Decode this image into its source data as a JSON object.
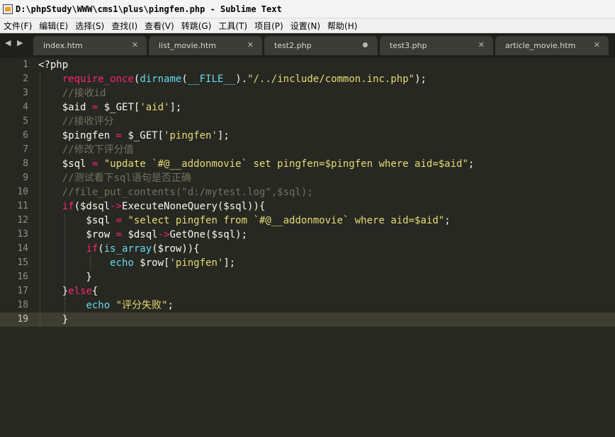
{
  "window": {
    "title": "D:\\phpStudy\\WWW\\cms1\\plus\\pingfen.php - Sublime Text"
  },
  "menu": [
    "文件(F)",
    "编辑(E)",
    "选择(S)",
    "查找(I)",
    "查看(V)",
    "转跳(G)",
    "工具(T)",
    "项目(P)",
    "设置(N)",
    "帮助(H)"
  ],
  "tabs": [
    {
      "label": "index.htm",
      "state": "close"
    },
    {
      "label": "list_movie.htm",
      "state": "close"
    },
    {
      "label": "test2.php",
      "state": "dirty"
    },
    {
      "label": "test3.php",
      "state": "close"
    },
    {
      "label": "article_movie.htm",
      "state": "close"
    }
  ],
  "nav": {
    "back": "◀",
    "forward": "▶"
  },
  "editor": {
    "current_line": 19,
    "lines": [
      [
        {
          "t": "<?php",
          "c": "pl"
        }
      ],
      [
        {
          "t": "    ",
          "c": "pl"
        },
        {
          "t": "require_once",
          "c": "kw"
        },
        {
          "t": "(",
          "c": "pl"
        },
        {
          "t": "dirname",
          "c": "fn"
        },
        {
          "t": "(",
          "c": "pl"
        },
        {
          "t": "__FILE__",
          "c": "fn"
        },
        {
          "t": ").",
          "c": "pl"
        },
        {
          "t": "\"/../include/common.inc.php\"",
          "c": "str"
        },
        {
          "t": ");",
          "c": "pl"
        }
      ],
      [
        {
          "t": "    ",
          "c": "pl"
        },
        {
          "t": "//接收id",
          "c": "cm"
        }
      ],
      [
        {
          "t": "    $aid ",
          "c": "pl"
        },
        {
          "t": "=",
          "c": "op"
        },
        {
          "t": " $_GET[",
          "c": "pl"
        },
        {
          "t": "'aid'",
          "c": "str"
        },
        {
          "t": "];",
          "c": "pl"
        }
      ],
      [
        {
          "t": "    ",
          "c": "pl"
        },
        {
          "t": "//接收评分",
          "c": "cm"
        }
      ],
      [
        {
          "t": "    $pingfen ",
          "c": "pl"
        },
        {
          "t": "=",
          "c": "op"
        },
        {
          "t": " $_GET[",
          "c": "pl"
        },
        {
          "t": "'pingfen'",
          "c": "str"
        },
        {
          "t": "];",
          "c": "pl"
        }
      ],
      [
        {
          "t": "    ",
          "c": "pl"
        },
        {
          "t": "//修改下评分值",
          "c": "cm"
        }
      ],
      [
        {
          "t": "    $sql ",
          "c": "pl"
        },
        {
          "t": "=",
          "c": "op"
        },
        {
          "t": " ",
          "c": "pl"
        },
        {
          "t": "\"update `#@__addonmovie` set pingfen=$pingfen where aid=$aid\"",
          "c": "str"
        },
        {
          "t": ";",
          "c": "pl"
        }
      ],
      [
        {
          "t": "    ",
          "c": "pl"
        },
        {
          "t": "//测试看下sql语句是否正确",
          "c": "cm"
        }
      ],
      [
        {
          "t": "    ",
          "c": "pl"
        },
        {
          "t": "//file_put_contents(\"d:/mytest.log\",$sql);",
          "c": "cm"
        }
      ],
      [
        {
          "t": "    ",
          "c": "pl"
        },
        {
          "t": "if",
          "c": "kw"
        },
        {
          "t": "($dsql",
          "c": "pl"
        },
        {
          "t": "->",
          "c": "op"
        },
        {
          "t": "ExecuteNoneQuery($sql)){",
          "c": "pl"
        }
      ],
      [
        {
          "t": "        $sql ",
          "c": "pl"
        },
        {
          "t": "=",
          "c": "op"
        },
        {
          "t": " ",
          "c": "pl"
        },
        {
          "t": "\"select pingfen from `#@__addonmovie` where aid=$aid\"",
          "c": "str"
        },
        {
          "t": ";",
          "c": "pl"
        }
      ],
      [
        {
          "t": "        $row ",
          "c": "pl"
        },
        {
          "t": "=",
          "c": "op"
        },
        {
          "t": " $dsql",
          "c": "pl"
        },
        {
          "t": "->",
          "c": "op"
        },
        {
          "t": "GetOne($sql);",
          "c": "pl"
        }
      ],
      [
        {
          "t": "        ",
          "c": "pl"
        },
        {
          "t": "if",
          "c": "kw"
        },
        {
          "t": "(",
          "c": "pl"
        },
        {
          "t": "is_array",
          "c": "fn"
        },
        {
          "t": "($row)){",
          "c": "pl"
        }
      ],
      [
        {
          "t": "            ",
          "c": "pl"
        },
        {
          "t": "echo",
          "c": "fn"
        },
        {
          "t": " $row[",
          "c": "pl"
        },
        {
          "t": "'pingfen'",
          "c": "str"
        },
        {
          "t": "];",
          "c": "pl"
        }
      ],
      [
        {
          "t": "        }",
          "c": "pl"
        }
      ],
      [
        {
          "t": "    }",
          "c": "pl"
        },
        {
          "t": "else",
          "c": "kw"
        },
        {
          "t": "{",
          "c": "pl"
        }
      ],
      [
        {
          "t": "        ",
          "c": "pl"
        },
        {
          "t": "echo",
          "c": "fn"
        },
        {
          "t": " ",
          "c": "pl"
        },
        {
          "t": "\"评分失败\"",
          "c": "str"
        },
        {
          "t": ";",
          "c": "pl"
        }
      ],
      [
        {
          "t": "    }",
          "c": "pl"
        }
      ]
    ]
  }
}
